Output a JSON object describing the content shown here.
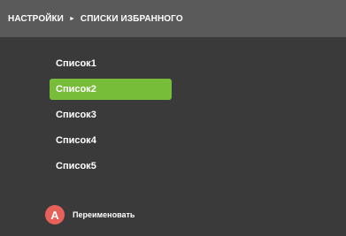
{
  "header": {
    "breadcrumb_root": "НАСТРОЙКИ",
    "breadcrumb_separator": "►",
    "breadcrumb_current": "СПИСКИ ИЗБРАННОГО"
  },
  "lists": [
    {
      "label": "Список1",
      "selected": false
    },
    {
      "label": "Список2",
      "selected": true
    },
    {
      "label": "Список3",
      "selected": false
    },
    {
      "label": "Список4",
      "selected": false
    },
    {
      "label": "Список5",
      "selected": false
    }
  ],
  "footer": {
    "button_key": "A",
    "action_label": "Переименовать"
  },
  "colors": {
    "background": "#3a3a3a",
    "header_background": "#5a5a5a",
    "selection": "#77bd3a",
    "button_a": "#e8605a"
  }
}
